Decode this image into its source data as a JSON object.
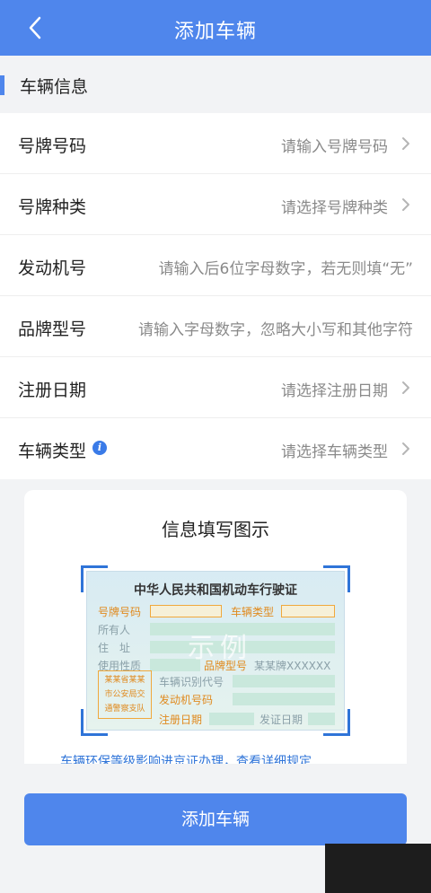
{
  "header": {
    "title": "添加车辆"
  },
  "section": {
    "title": "车辆信息"
  },
  "form": {
    "rows": [
      {
        "label": "号牌号码",
        "placeholder": "请输入号牌号码"
      },
      {
        "label": "号牌种类",
        "placeholder": "请选择号牌种类"
      },
      {
        "label": "发动机号",
        "placeholder": "请输入后6位字母数字，若无则填“无”"
      },
      {
        "label": "品牌型号",
        "placeholder": "请输入字母数字，忽略大小写和其他字符"
      },
      {
        "label": "注册日期",
        "placeholder": "请选择注册日期"
      },
      {
        "label": "车辆类型",
        "placeholder": "请选择车辆类型"
      }
    ],
    "info_icon_glyph": "i"
  },
  "illustration": {
    "title": "信息填写图示",
    "license": {
      "title": "中华人民共和国机动车行驶证",
      "plate_label": "号牌号码",
      "vehicle_type_label": "车辆类型",
      "owner_label": "所有人",
      "address_label": "住　址",
      "usage_label": "使用性质",
      "brand_label": "品牌型号",
      "brand_value": "某某牌XXXXXX",
      "vin_label": "车辆识别代号",
      "engine_label": "发动机号码",
      "register_label": "注册日期",
      "issue_label": "发证日期",
      "stamp_lines": [
        "某某省某某",
        "市公安局交",
        "通警察支队"
      ],
      "watermark": "示例"
    },
    "notice": "车辆环保等级影响进京证办理，查看详细规定"
  },
  "footer": {
    "add_button": "添加车辆"
  },
  "colors": {
    "brand": "#4f86ec",
    "link": "#2f74d8",
    "highlight": "#e08a1e"
  }
}
